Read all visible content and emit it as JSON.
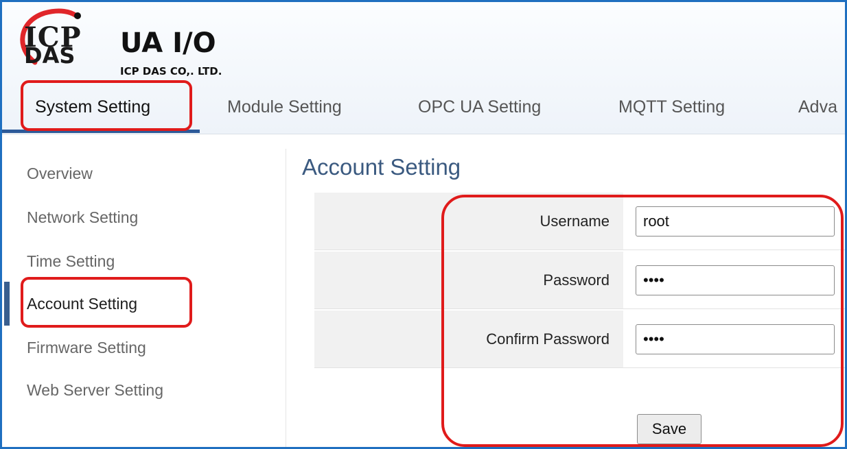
{
  "brand": {
    "logo_top": "ICP",
    "logo_bottom": "DAS",
    "product": "UA I/O",
    "company": "ICP DAS CO,. LTD."
  },
  "tabs": [
    {
      "label": "System Setting",
      "active": true
    },
    {
      "label": "Module Setting",
      "active": false
    },
    {
      "label": "OPC UA Setting",
      "active": false
    },
    {
      "label": "MQTT Setting",
      "active": false
    },
    {
      "label": "Adva",
      "active": false
    }
  ],
  "sidebar": {
    "items": [
      {
        "label": "Overview"
      },
      {
        "label": "Network Setting"
      },
      {
        "label": "Time Setting"
      },
      {
        "label": "Account Setting",
        "active": true
      },
      {
        "label": "Firmware Setting"
      },
      {
        "label": "Web Server Setting"
      }
    ]
  },
  "main": {
    "title": "Account Setting",
    "fields": [
      {
        "label": "Username",
        "value": "root",
        "type": "text"
      },
      {
        "label": "Password",
        "value": "••••",
        "type": "password"
      },
      {
        "label": "Confirm Password",
        "value": "••••",
        "type": "password"
      }
    ],
    "save_label": "Save"
  },
  "colors": {
    "accent": "#2d5a99",
    "highlight": "#e01b1b",
    "frame": "#1f6fc0",
    "title": "#3b5a80"
  }
}
